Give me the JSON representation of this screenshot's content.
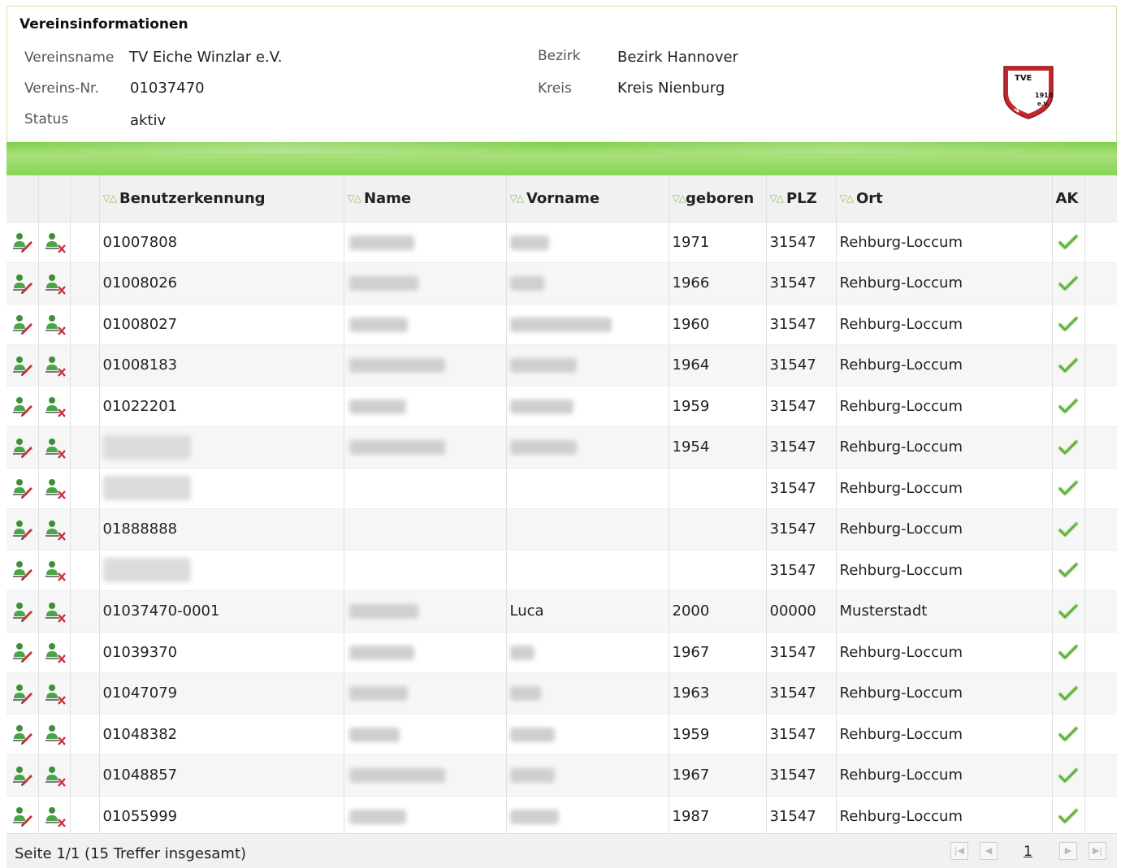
{
  "club_info": {
    "title": "Vereinsinformationen",
    "name_label": "Vereinsname",
    "name_value": "TV Eiche Winzlar e.V.",
    "number_label": "Vereins-Nr.",
    "number_value": "01037470",
    "status_label": "Status",
    "status_value": "aktiv",
    "district_label": "Bezirk",
    "district_value": "Bezirk Hannover",
    "county_label": "Kreis",
    "county_value": "Kreis Nienburg",
    "logo_text_top": "TVE",
    "logo_text_mid": "WINZLAR",
    "logo_text_year": "1910",
    "logo_text_ev": "e.V."
  },
  "table": {
    "sort_glyph": "▽△",
    "columns": {
      "user_id": "Benutzerkennung",
      "last_name": "Name",
      "first_name": "Vorname",
      "born": "geboren",
      "zip": "PLZ",
      "city": "Ort",
      "ak": "AK"
    },
    "rows": [
      {
        "user_id": "01007808",
        "born": "1971",
        "zip": "31547",
        "city": "Rehburg-Loccum"
      },
      {
        "user_id": "01008026",
        "born": "1966",
        "zip": "31547",
        "city": "Rehburg-Loccum"
      },
      {
        "user_id": "01008027",
        "born": "1960",
        "zip": "31547",
        "city": "Rehburg-Loccum"
      },
      {
        "user_id": "01008183",
        "born": "1964",
        "zip": "31547",
        "city": "Rehburg-Loccum"
      },
      {
        "user_id": "01022201",
        "born": "1959",
        "zip": "31547",
        "city": "Rehburg-Loccum"
      },
      {
        "user_id": "",
        "born": "1954",
        "zip": "31547",
        "city": "Rehburg-Loccum"
      },
      {
        "user_id": "",
        "born": "",
        "zip": "31547",
        "city": "Rehburg-Loccum"
      },
      {
        "user_id": "01888888",
        "born": "",
        "zip": "31547",
        "city": "Rehburg-Loccum"
      },
      {
        "user_id": "",
        "born": "",
        "zip": "31547",
        "city": "Rehburg-Loccum"
      },
      {
        "user_id": "01037470-0001",
        "first_name": "Luca",
        "born": "2000",
        "zip": "00000",
        "city": "Musterstadt"
      },
      {
        "user_id": "01039370",
        "born": "1967",
        "zip": "31547",
        "city": "Rehburg-Loccum"
      },
      {
        "user_id": "01047079",
        "born": "1963",
        "zip": "31547",
        "city": "Rehburg-Loccum"
      },
      {
        "user_id": "01048382",
        "born": "1959",
        "zip": "31547",
        "city": "Rehburg-Loccum"
      },
      {
        "user_id": "01048857",
        "born": "1967",
        "zip": "31547",
        "city": "Rehburg-Loccum"
      },
      {
        "user_id": "01055999",
        "born": "1987",
        "zip": "31547",
        "city": "Rehburg-Loccum"
      }
    ]
  },
  "footer": {
    "summary": "Seite 1/1 (15 Treffer insgesamt)",
    "current_page": "1"
  },
  "colors": {
    "accent_green": "#7fd04a",
    "check_green": "#5cae3c",
    "delete_red": "#c0282d"
  }
}
